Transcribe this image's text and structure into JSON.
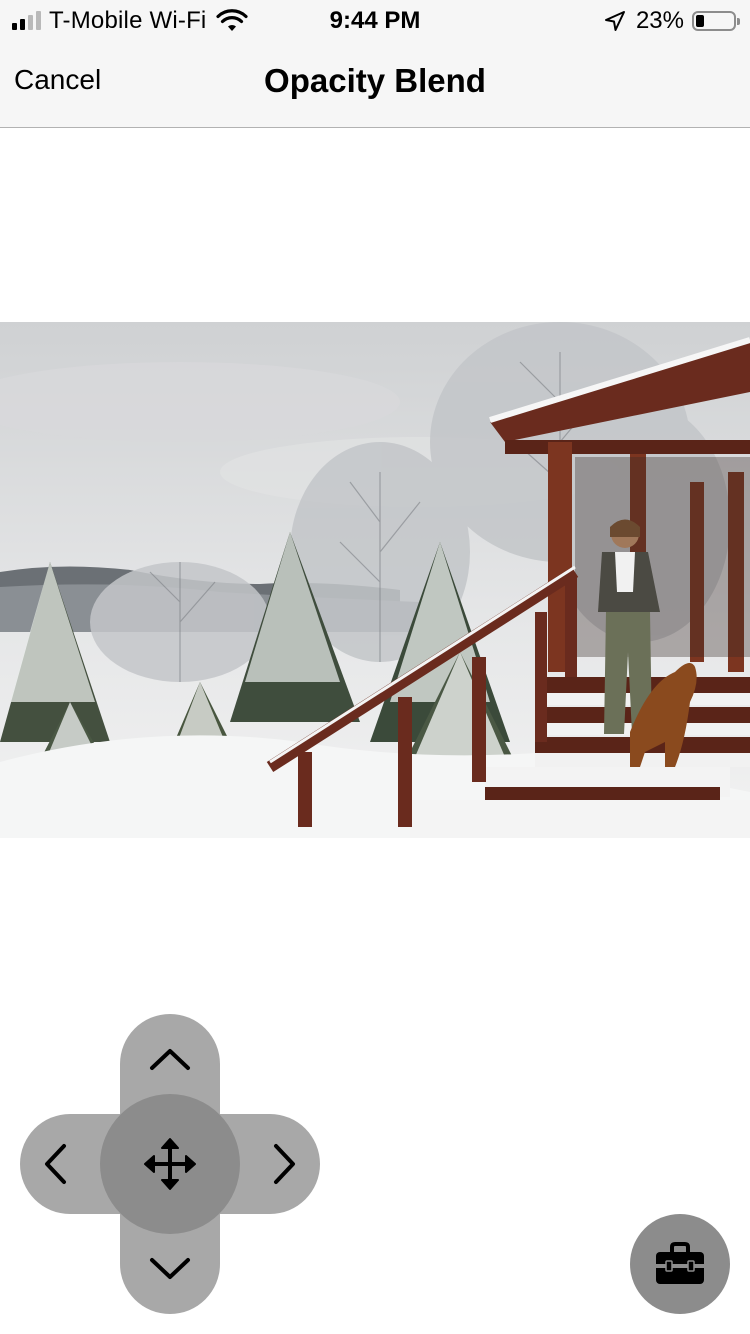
{
  "status_bar": {
    "carrier": "T-Mobile Wi-Fi",
    "time": "9:44 PM",
    "battery_percent": "23%",
    "battery_level": 0.23,
    "signal_bars_filled": 2,
    "signal_bars_total": 4,
    "icons": [
      "signal-bars-icon",
      "wifi-icon",
      "location-arrow-icon",
      "battery-icon"
    ]
  },
  "nav": {
    "cancel_label": "Cancel",
    "title": "Opacity Blend"
  },
  "photo": {
    "description_icon": "snowy-cabin-photo"
  },
  "controls": {
    "dpad_icons": [
      "chevron-up-icon",
      "chevron-down-icon",
      "chevron-left-icon",
      "chevron-right-icon",
      "move-arrows-icon"
    ],
    "fab_icon": "toolbox-icon",
    "colors": {
      "dpad_arm": "#a8a8a8",
      "dpad_center": "#8c8c8c",
      "fab": "#8c8c8c"
    }
  }
}
